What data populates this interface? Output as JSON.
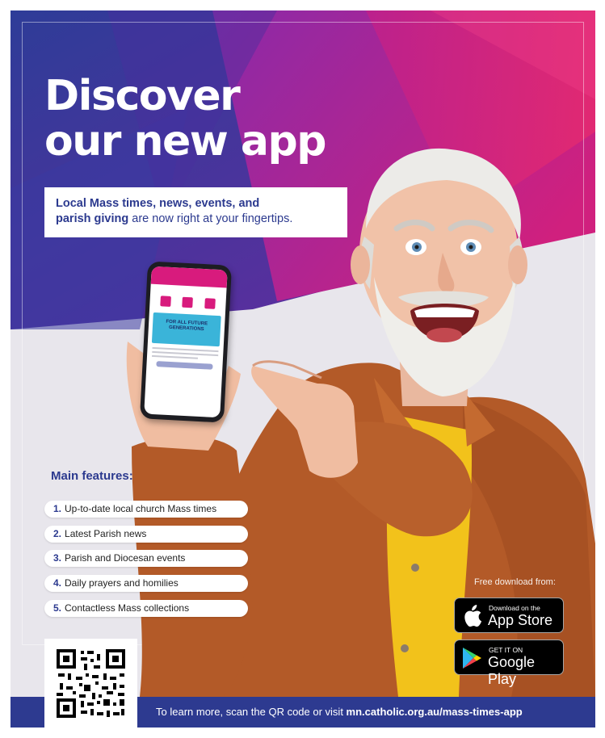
{
  "headline": {
    "line1": "Discover",
    "line2": "our new app"
  },
  "tagline": {
    "bold1": "Local Mass times, news, events, and",
    "bold2": "parish giving",
    "rest": " are now right at your fingertips."
  },
  "phone": {
    "banner_text": "FOR ALL FUTURE GENERATIONS"
  },
  "features": {
    "title": "Main features:",
    "items": [
      {
        "num": "1.",
        "label": "Up-to-date local church Mass times"
      },
      {
        "num": "2.",
        "label": "Latest Parish news"
      },
      {
        "num": "3.",
        "label": "Parish and Diocesan events"
      },
      {
        "num": "4.",
        "label": "Daily prayers and homilies"
      },
      {
        "num": "5.",
        "label": "Contactless Mass collections"
      }
    ]
  },
  "download": {
    "label": "Free download from:",
    "app_store": {
      "small": "Download on the",
      "big": "App Store",
      "icon": "apple-icon"
    },
    "google_play": {
      "small": "GET IT ON",
      "big": "Google Play",
      "icon": "google-play-icon"
    }
  },
  "footer": {
    "text": "To learn more, scan the QR code or visit ",
    "url": "mn.catholic.org.au/mass-times-app"
  },
  "colors": {
    "brand_blue": "#2d3a90",
    "magenta": "#d81b7d",
    "purple": "#7a2a9c",
    "shirt_orange": "#b85a26",
    "tshirt_yellow": "#f2c21b"
  }
}
